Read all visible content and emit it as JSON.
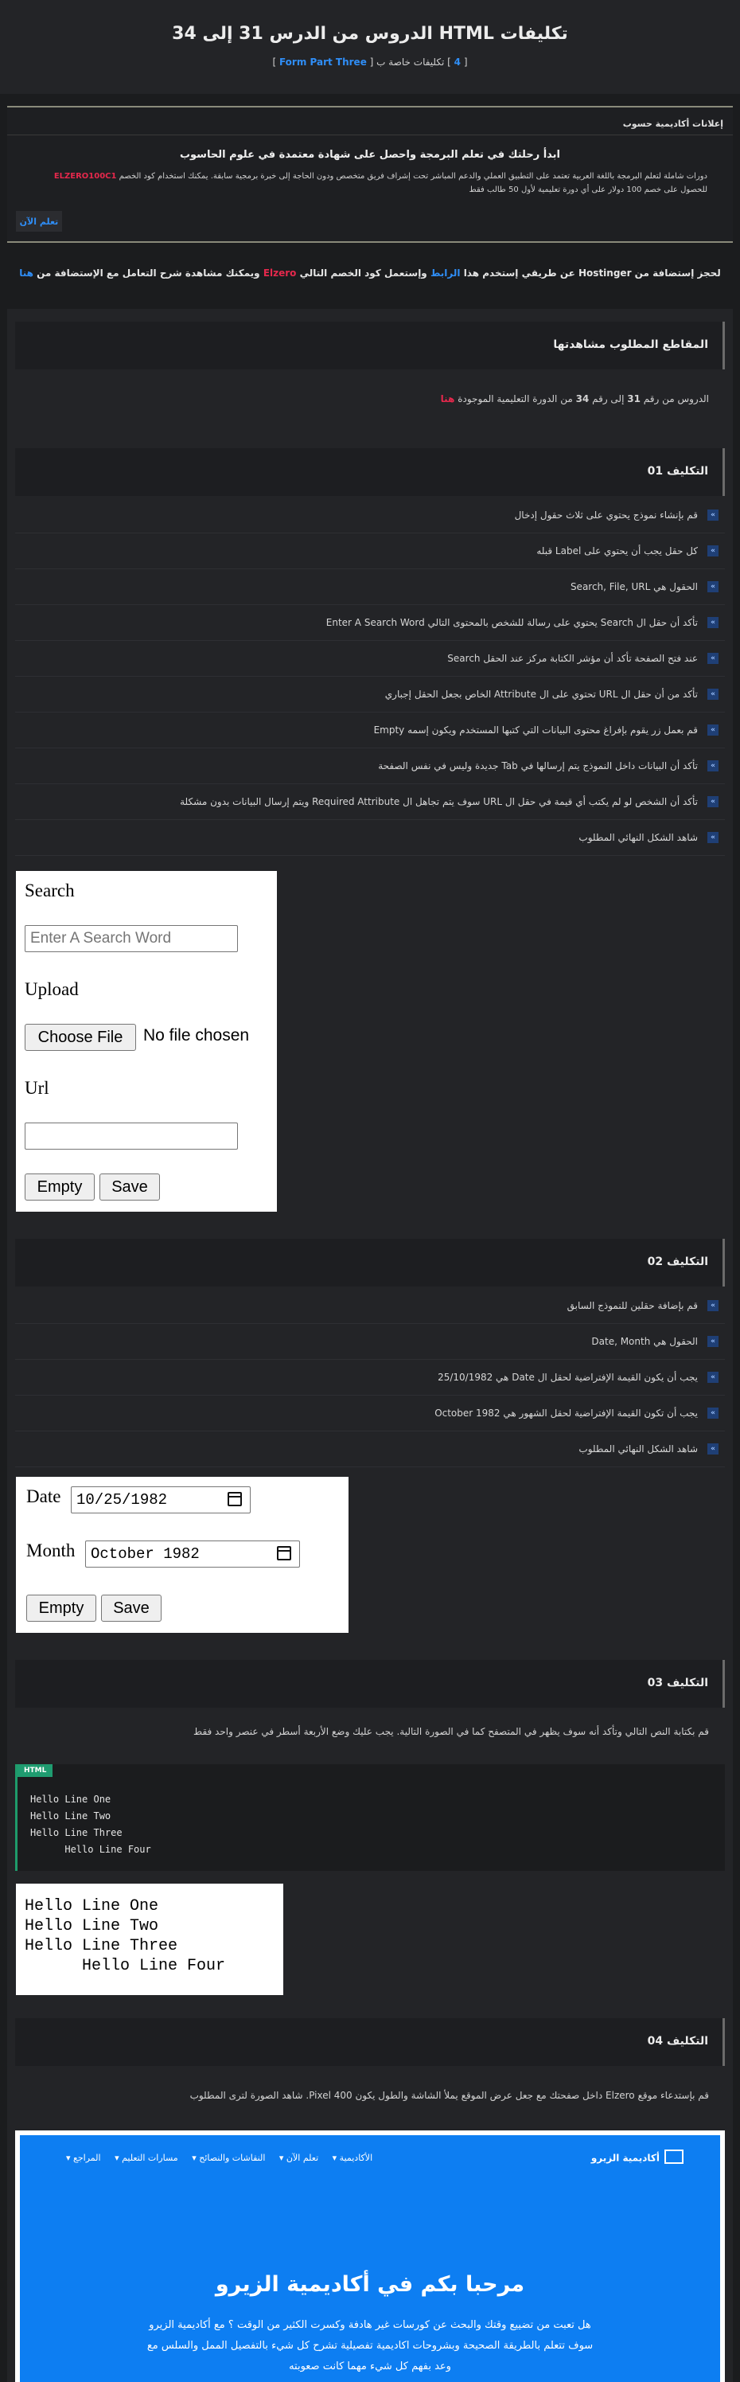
{
  "header": {
    "title": "تكليفات HTML الدروس من الدرس 31 إلى 34",
    "subtitle_prefix": "[ ",
    "subtitle_count": "4",
    "subtitle_mid": " ] تكليفات خاصة ب [ ",
    "subtitle_part": "Form Part Three",
    "subtitle_suffix": " ]"
  },
  "ads": {
    "title": "إعلانات أكاديمية حسوب",
    "headline": "ابدأ رحلتك في تعلم البرمجة واحصل على شهادة معتمدة في علوم الحاسوب",
    "desc_a": "دورات شاملة لتعلم البرمجة باللغة العربية تعتمد على التطبيق العملي والدعم المباشر تحت إشراف فريق متخصص ودون الحاجة إلى خبرة برمجية سابقة. يمكنك استخدام كود الخصم ",
    "desc_code": "ELZERO100C1",
    "desc_b": " للحصول على خصم 100 دولار على أي دورة تعليمية لأول 50 طالب فقط",
    "button": "تعلم الآن"
  },
  "hosting": {
    "a": "لحجز إستضافة من Hostinger عن طريقي إستخدم هذا ",
    "link1": "الرابط",
    "b": " وإستعمل كود الخصم التالي ",
    "code": "Elzero",
    "c": " ويمكنك مشاهدة شرح التعامل مع الإستضافة من ",
    "link2": "هنا"
  },
  "sections": {
    "videos_title": "المقاطع المطلوب مشاهدتها",
    "videos_text_a": "الدروس من رقم ",
    "videos_from": "31",
    "videos_text_b": " إلى رقم ",
    "videos_to": "34",
    "videos_text_c": " من الدورة التعليمية الموجودة ",
    "videos_link": "هنا",
    "task1_title": "التكليف 01",
    "task2_title": "التكليف 02",
    "task3_title": "التكليف 03",
    "task4_title": "التكليف 04",
    "task3_text": "قم بكتابة النص التالي وتأكد أنه سوف يظهر في المتصفح كما في الصورة التالية. يجب عليك وضع الأربعة أسطر في عنصر واحد فقط",
    "task4_text": "قم بإستدعاء موقع Elzero داخل صفحتك مع جعل عرض الموقع يملأ الشاشة والطول يكون 400 Pixel. شاهد الصورة لترى المطلوب"
  },
  "task1_items": [
    "قم بإنشاء نموذج يحتوي على ثلاث حقول إدخال",
    "كل حقل يجب أن يحتوي على Label قبله",
    "الحقول هي Search, File, URL",
    "تأكد أن حقل ال Search يحتوي على رسالة للشخص بالمحتوى التالي Enter A Search Word",
    "عند فتح الصفحة تأكد أن مؤشر الكتابة مركز عند الحقل Search",
    "تأكد من أن حقل ال URL تحتوي على ال Attribute الخاص بجعل الحقل إجباري",
    "قم بعمل زر يقوم بإفراغ محتوى البيانات التي كتبها المستخدم ويكون إسمه Empty",
    "تأكد أن البيانات داخل النموذج يتم إرسالها في Tab جديدة وليس في نفس الصفحة",
    "تأكد أن الشخص لو لم يكتب أي قيمة في حقل ال URL سوف يتم تجاهل ال Required Attribute ويتم إرسال البيانات بدون مشكلة",
    "شاهد الشكل النهائي المطلوب"
  ],
  "task2_items": [
    "قم بإضافة حقلين للنموذج السابق",
    "الحقول هي Date, Month",
    "يجب أن يكون القيمة الإفتراضية لحقل ال Date هي 25/10/1982",
    "يجب أن تكون القيمة الإفتراضية لحقل الشهور هي October 1982",
    "شاهد الشكل النهائي المطلوب"
  ],
  "bullet_glyph": "»",
  "demo1": {
    "search_label": "Search",
    "search_placeholder": "Enter A Search Word",
    "upload_label": "Upload",
    "file_button": "Choose File",
    "file_status": "No file chosen",
    "url_label": "Url",
    "empty_button": "Empty",
    "save_button": "Save"
  },
  "demo2": {
    "date_label": "Date",
    "date_value": "10/25/1982",
    "month_label": "Month",
    "month_value": "October 1982",
    "empty_button": "Empty",
    "save_button": "Save"
  },
  "code": {
    "tag": "HTML",
    "lines": "Hello Line One\nHello Line Two\nHello Line Three\n      Hello Line Four"
  },
  "demo3": {
    "lines": "Hello Line One\nHello Line Two\nHello Line Three\n      Hello Line Four"
  },
  "site": {
    "logo": "أكاديمية الزيرو",
    "nav": [
      "الأكاديمية ▾",
      "تعلم الآن ▾",
      "النقاشات والنصائح ▾",
      "مسارات التعليم ▾",
      "المراجع ▾"
    ],
    "heading": "مرحبا بكم في أكاديمية الزيرو",
    "text": "هل تعبت من تضييع وقتك والبحث عن كورسات غير هادفة وكسرت الكثير من الوقت ؟ مع أكاديمية الزيرو سوف تتعلم بالطريقة الصحيحة وبشروحات اكاديمية تفصيلية تشرح كل شيء بالتفصيل الممل والسلس مع وعد بفهم كل شيء مهما كانت صعوبته"
  },
  "colors": {
    "accent_blue": "#2f8ef7",
    "accent_red": "#e5284c",
    "code_tag": "#1f9c70",
    "site_blue": "#0d7ef2"
  }
}
